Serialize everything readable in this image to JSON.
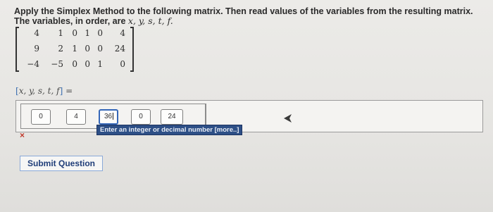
{
  "instructions": {
    "line1": "Apply the Simplex Method to the following matrix. Then read values of the variables from the resulting matrix.",
    "line2_prefix": "The variables, in order, are ",
    "line2_vars": "x, y, s, t, f."
  },
  "matrix": {
    "rows": [
      [
        "4",
        "1",
        "0",
        "1",
        "0",
        "4"
      ],
      [
        "9",
        "2",
        "1",
        "0",
        "0",
        "24"
      ],
      [
        "−4",
        "−5",
        "0",
        "0",
        "1",
        "0"
      ]
    ]
  },
  "variables_label": {
    "open": "[",
    "vars": "x, y, s, t, f",
    "close": "]",
    "equals": " ="
  },
  "answer": {
    "fields": [
      "0",
      "4",
      "36",
      "0",
      "24"
    ],
    "tooltip": "Enter an integer or decimal number [more..]",
    "status_mark": "×"
  },
  "submit": {
    "label": "Submit Question"
  },
  "colors": {
    "accent": "#3567b8",
    "tooltip_bg": "#2d4f86",
    "error": "#c0392b"
  }
}
